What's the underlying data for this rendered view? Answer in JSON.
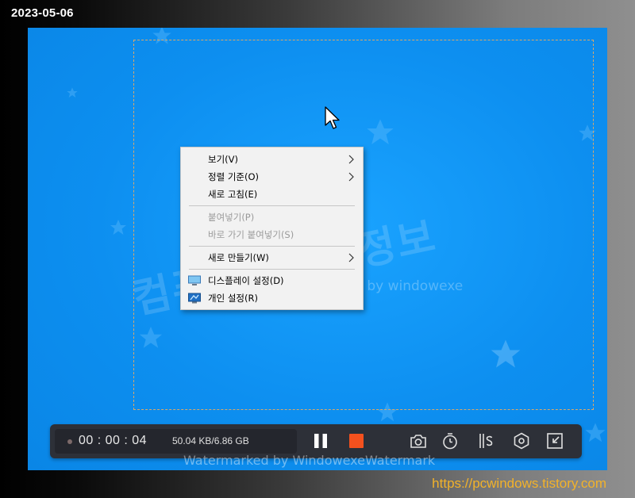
{
  "date": "2023-05-06",
  "url": "https://pcwindows.tistory.com",
  "watermark": {
    "korean": "컴퓨터 관련 정보",
    "overlay": "watermark by windowexe",
    "bottom": "Watermarked by WindowexeWatermark"
  },
  "context_menu": {
    "items": [
      {
        "label": "보기(V)",
        "submenu": true
      },
      {
        "label": "정렬 기준(O)",
        "submenu": true
      },
      {
        "label": "새로 고침(E)"
      },
      {
        "label": "붙여넣기(P)",
        "disabled": true
      },
      {
        "label": "바로 가기 붙여넣기(S)",
        "disabled": true
      },
      {
        "label": "새로 만들기(W)",
        "submenu": true
      },
      {
        "label": "디스플레이 설정(D)",
        "icon": "display-icon"
      },
      {
        "label": "개인 설정(R)",
        "icon": "personalize-icon"
      }
    ]
  },
  "recorder": {
    "time": "00 : 00 : 04",
    "size": "50.04 KB/6.86 GB",
    "buttons": [
      "pause-icon",
      "stop-icon",
      "camera-icon",
      "timer-icon",
      "brush-icon",
      "settings-icon",
      "collapse-icon"
    ],
    "stop_color": "#f4511e"
  },
  "colors": {
    "desktop": "#0d8ff0",
    "selection_border": "#d9a86a",
    "url": "#f2b22a"
  }
}
